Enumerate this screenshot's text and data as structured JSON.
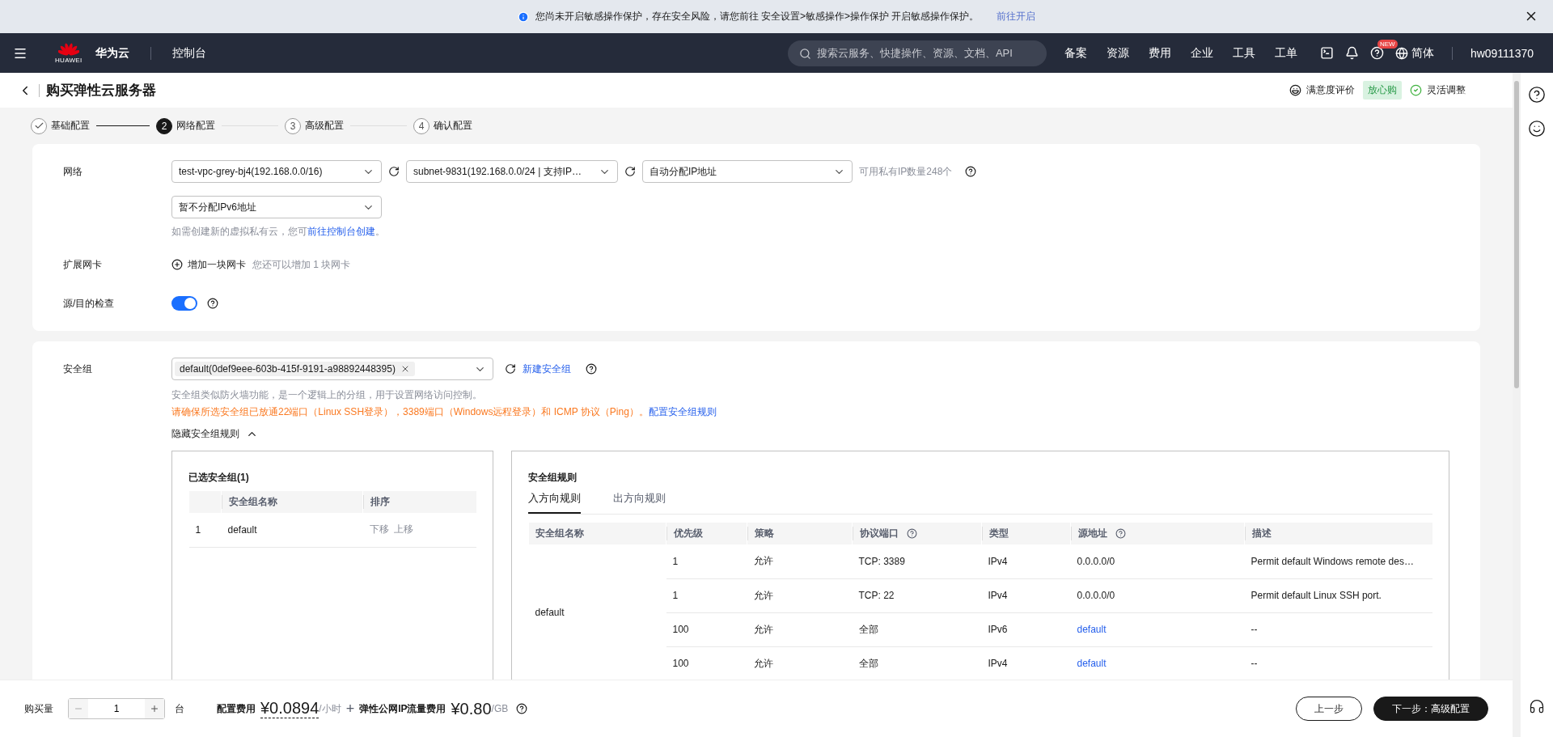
{
  "notice": {
    "text": "您尚未开启敏感操作保护，存在安全风险，请您前往 安全设置>敏感操作>操作保护 开启敏感操作保护。",
    "link": "前往开启"
  },
  "topbar": {
    "logo_caption": "HUAWEI",
    "brand": "华为云",
    "console": "控制台",
    "search": {
      "placeholder": "搜索云服务、快捷操作、资源、文档、API"
    },
    "links": [
      "备案",
      "资源",
      "费用",
      "企业",
      "工具",
      "工单"
    ],
    "badge": "NEW",
    "language": "简体",
    "user": "hw09111370"
  },
  "header": {
    "title": "购买弹性云服务器",
    "feedback": "满意度评价",
    "assurance": "放心购",
    "flexible": "灵活调整"
  },
  "steps": [
    {
      "label": "基础配置",
      "kind": "done"
    },
    {
      "number": "2",
      "label": "网络配置",
      "kind": "current"
    },
    {
      "number": "3",
      "label": "高级配置",
      "kind": "todo"
    },
    {
      "number": "4",
      "label": "确认配置",
      "kind": "todo"
    }
  ],
  "network": {
    "label": "网络",
    "vpc": "test-vpc-grey-bj4(192.168.0.0/16)",
    "subnet": "subnet-9831(192.168.0.0/24 | 支持IP…",
    "ip_mode": "自动分配IP地址",
    "ip_count": "可用私有IP数量248个",
    "ipv6": "暂不分配IPv6地址",
    "hint_before": "如需创建新的虚拟私有云，您可",
    "hint_link": "前往控制台创建",
    "hint_after": "。"
  },
  "extra_nic": {
    "label": "扩展网卡",
    "action": "增加一块网卡",
    "hint": "您还可以增加 1 块网卡"
  },
  "source_check": {
    "label": "源/目的检查",
    "on": true
  },
  "security_group": {
    "label": "安全组",
    "selected_tag": "default(0def9eee-603b-415f-9191-a98892448395)",
    "create_link": "新建安全组",
    "hint": "安全组类似防火墙功能，是一个逻辑上的分组，用于设置网络访问控制。",
    "warning": "请确保所选安全组已放通22端口（Linux SSH登录），3389端口（Windows远程登录）和 ICMP 协议（Ping）。",
    "warning_link": "配置安全组规则",
    "toggle_rules": "隐藏安全组规则",
    "selected_panel": {
      "title": "已选安全组(1)",
      "columns": [
        "安全组名称",
        "排序"
      ],
      "rows": [
        {
          "index": "1",
          "name": "default",
          "move_down": "下移",
          "move_up": "上移"
        }
      ]
    },
    "rules_panel": {
      "title": "安全组规则",
      "tabs": [
        {
          "label": "入方向规则",
          "selected": true
        },
        {
          "label": "出方向规则",
          "selected": false
        }
      ],
      "columns": [
        {
          "label": "安全组名称",
          "help": false
        },
        {
          "label": "优先级",
          "help": false
        },
        {
          "label": "策略",
          "help": false
        },
        {
          "label": "协议端口",
          "help": true
        },
        {
          "label": "类型",
          "help": false
        },
        {
          "label": "源地址",
          "help": true
        },
        {
          "label": "描述",
          "help": false
        }
      ],
      "group_name": "default",
      "rows": [
        {
          "priority": "1",
          "policy": "允许",
          "port": "TCP: 3389",
          "type": "IPv4",
          "source": "0.0.0.0/0",
          "source_link": false,
          "description": "Permit default Windows remote des…"
        },
        {
          "priority": "1",
          "policy": "允许",
          "port": "TCP: 22",
          "type": "IPv4",
          "source": "0.0.0.0/0",
          "source_link": false,
          "description": "Permit default Linux SSH port."
        },
        {
          "priority": "100",
          "policy": "允许",
          "port": "全部",
          "type": "IPv6",
          "source": "default",
          "source_link": true,
          "description": "--"
        },
        {
          "priority": "100",
          "policy": "允许",
          "port": "全部",
          "type": "IPv4",
          "source": "default",
          "source_link": true,
          "description": "--"
        }
      ]
    }
  },
  "footer": {
    "quantity_label": "购买量",
    "quantity": "1",
    "unit": "台",
    "config_fee_label": "配置费用",
    "config_fee": "¥0.0894",
    "config_fee_unit": "/小时",
    "plus": "+",
    "traffic_fee_label": "弹性公网IP流量费用",
    "traffic_fee": "¥0.80",
    "traffic_fee_unit": "/GB",
    "prev": "上一步",
    "next": "下一步：高级配置"
  }
}
